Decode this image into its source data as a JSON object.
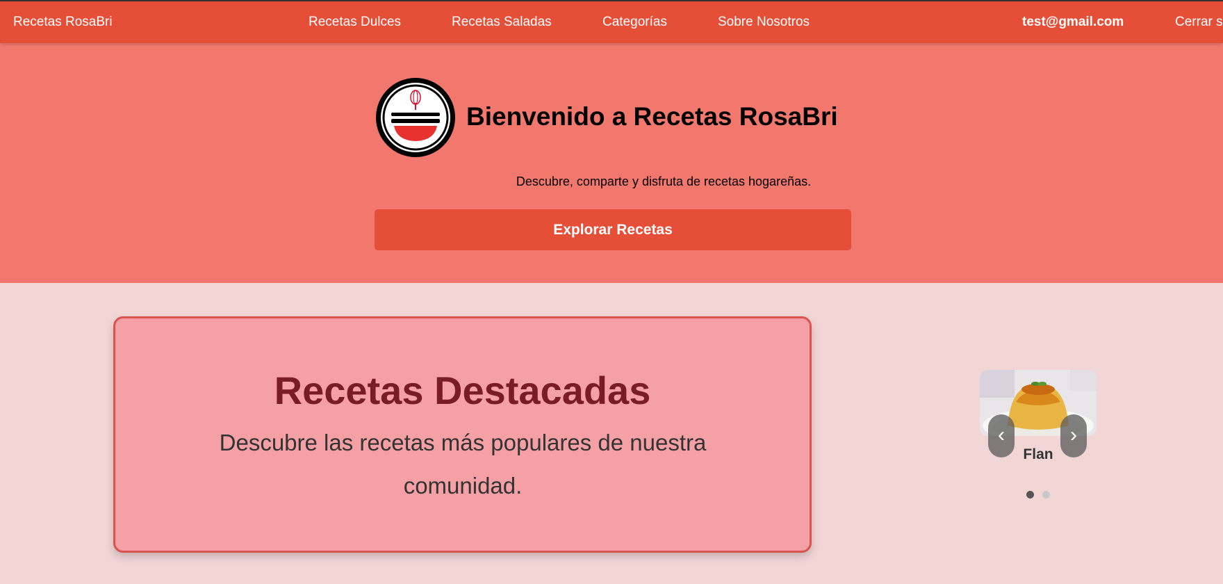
{
  "nav": {
    "brand": "Recetas RosaBri",
    "links": [
      "Recetas Dulces",
      "Recetas Saladas",
      "Categorías",
      "Sobre Nosotros"
    ],
    "user_email": "test@gmail.com",
    "logout": "Cerrar s"
  },
  "hero": {
    "title": "Bienvenido a Recetas RosaBri",
    "subtitle": "Descubre, comparte y disfruta de recetas hogareñas.",
    "button": "Explorar Recetas"
  },
  "featured": {
    "title": "Recetas Destacadas",
    "description": "Descubre las recetas más populares de nuestra comunidad."
  },
  "carousel": {
    "caption": "Flan",
    "prev_label": "‹",
    "next_label": "›",
    "slide_count": 2,
    "active_index": 0
  },
  "colors": {
    "primary": "#e54f37",
    "hero_bg": "#f2786d",
    "page_bg": "#f2d6d6",
    "card_bg": "#f4a0a5",
    "card_border": "#d9534f",
    "featured_title": "#7a1c24"
  },
  "icons": {
    "logo": "bowl-whisk-logo-icon",
    "prev": "chevron-left-icon",
    "next": "chevron-right-icon"
  }
}
